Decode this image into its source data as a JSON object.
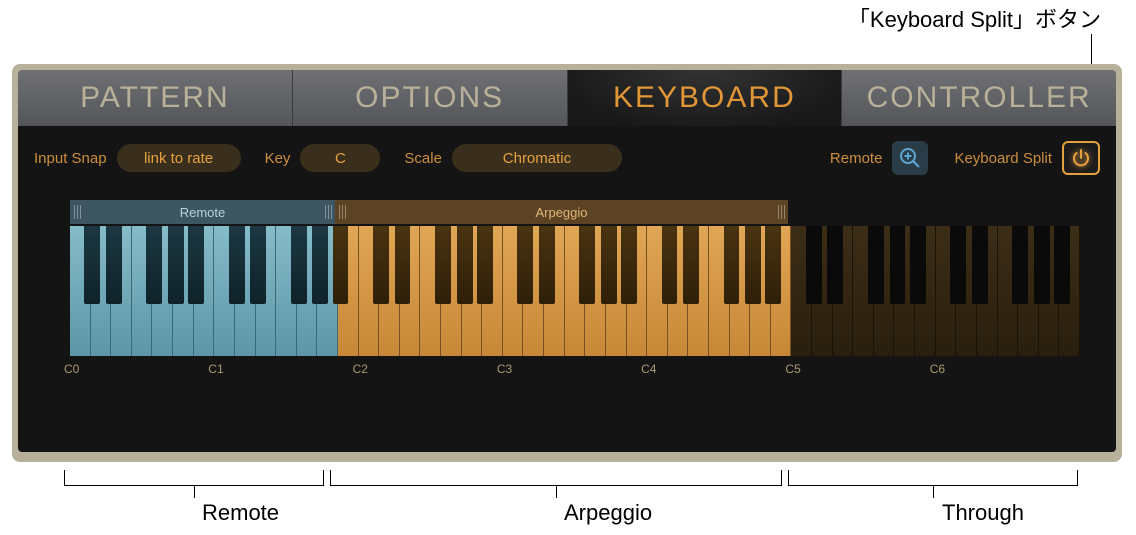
{
  "callouts": {
    "top": "「Keyboard Split」ボタン",
    "bottom": [
      "Remote",
      "Arpeggio",
      "Through"
    ]
  },
  "tabs": [
    {
      "label": "PATTERN",
      "active": false
    },
    {
      "label": "OPTIONS",
      "active": false
    },
    {
      "label": "KEYBOARD",
      "active": true
    },
    {
      "label": "CONTROLLER",
      "active": false
    }
  ],
  "controls": {
    "input_snap_label": "Input Snap",
    "input_snap_value": "link to rate",
    "key_label": "Key",
    "key_value": "C",
    "scale_label": "Scale",
    "scale_value": "Chromatic",
    "remote_label": "Remote",
    "split_label": "Keyboard Split"
  },
  "zones": {
    "remote": "Remote",
    "arpeggio": "Arpeggio"
  },
  "note_labels": [
    "C0",
    "C1",
    "C2",
    "C3",
    "C4",
    "C5",
    "C6"
  ],
  "colors": {
    "accent": "#e6a13f",
    "remote_zone": "#86bcc9",
    "arpeggio_zone": "#e0a656"
  },
  "icons": {
    "zoom": "zoom-plus-icon",
    "power": "power-icon"
  }
}
